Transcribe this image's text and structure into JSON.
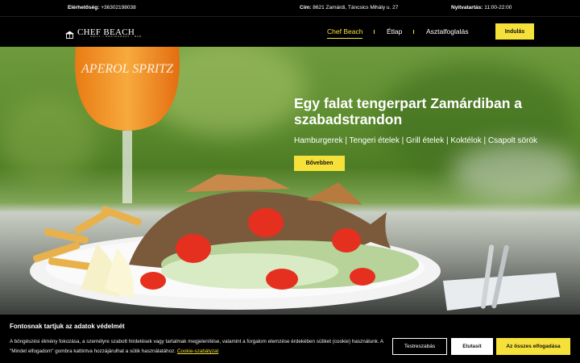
{
  "topbar": {
    "contact_label": "Elérhetőség:",
    "contact_value": "+36302198038",
    "address_label": "Cím:",
    "address_value": "8621 Zamárdi, Táncsics Mihály u. 27",
    "hours_label": "Nyitvatartás:",
    "hours_value": "11:00-22:00"
  },
  "logo": {
    "brand": "CHEF BEACH",
    "sub": "GRILL • RESTAURANT • BAR"
  },
  "nav": {
    "items": [
      "Chef Beach",
      "Étlap",
      "Asztalfoglalás"
    ],
    "cta": "Indulás"
  },
  "hero": {
    "title": "Egy falat tengerpart Zamárdiban a szabadstrandon",
    "tags": "Hamburgerek | Tengeri ételek | Grill ételek | Koktélok | Csapolt sörök",
    "button": "Bővebben",
    "glass_text": "APEROL SPRITZ"
  },
  "cookie": {
    "title": "Fontosnak tartjuk az adatok védelmét",
    "text": "A böngészési élmény fokozása, a személyre szabott hirdetések vagy tartalmak megjelenítése, valamint a forgalom elemzése érdekében sütiket (cookie) használunk. A \"Mindet elfogadom\" gombra kattintva hozzájárulhat a sütik használatához.",
    "link": "Cookie-szabályzat",
    "buttons": {
      "customize": "Testreszabás",
      "reject": "Elutasít",
      "accept": "Az összes elfogadása"
    }
  },
  "colors": {
    "accent": "#f5e13a",
    "background": "#000000"
  }
}
